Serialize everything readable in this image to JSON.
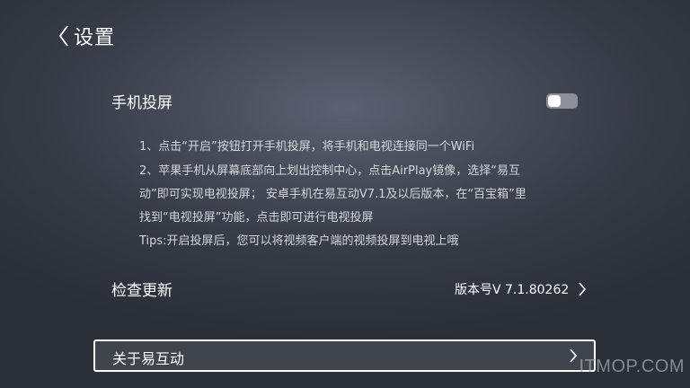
{
  "header": {
    "title": "设置"
  },
  "screen_cast": {
    "label": "手机投屏",
    "toggle_on": false,
    "description": [
      "1、点击“开启”按钮打开手机投屏，将手机和电视连接同一个WiFi",
      "2、苹果手机从屏幕底部向上划出控制中心，点击AirPlay镜像，选择“易互",
      "动”即可实现电视投屏；  安卓手机在易互动V7.1及以后版本，在“百宝箱”里",
      "找到“电视投屏”功能，点击即可进行电视投屏",
      "Tips:开启投屏后，您可以将视频客户端的视频投屏到电视上哦"
    ]
  },
  "update": {
    "label": "检查更新",
    "version": "版本号V 7.1.80262"
  },
  "about": {
    "label": "关于易互动"
  },
  "watermark": "ITMOP.COM",
  "icons": {
    "back": "chevron-left-icon",
    "version_arrow": "chevron-right-icon",
    "about_arrow": "chevron-right-icon"
  },
  "colors": {
    "text": "#ffffff",
    "description": "#d5d7db",
    "toggle_track": "#8c9099",
    "toggle_knob": "#ffffff",
    "focus_border": "#ffffff"
  }
}
